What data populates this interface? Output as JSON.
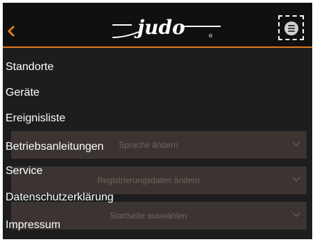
{
  "header": {
    "logo_text": "judo",
    "back_icon": "chevron-left-icon",
    "menu_icon": "hamburger-menu-icon"
  },
  "navigation": {
    "items": [
      {
        "label": "Standorte"
      },
      {
        "label": "Geräte"
      },
      {
        "label": "Ereignisliste"
      },
      {
        "label": "Betriebsanleitungen"
      },
      {
        "label": "Service"
      },
      {
        "label": "Datenschutzerklärung"
      },
      {
        "label": "Impressum"
      }
    ]
  },
  "settings": {
    "rows": [
      {
        "label": "Sprache ändern"
      },
      {
        "label": "Registrierungsdaten ändern"
      },
      {
        "label": "Startseite auswählen"
      }
    ]
  },
  "colors": {
    "accent": "#e07a1e",
    "header_bg": "#101010",
    "content_bg": "#1d1d1d",
    "row_bg": "#3b3430",
    "text": "#ffffff"
  }
}
